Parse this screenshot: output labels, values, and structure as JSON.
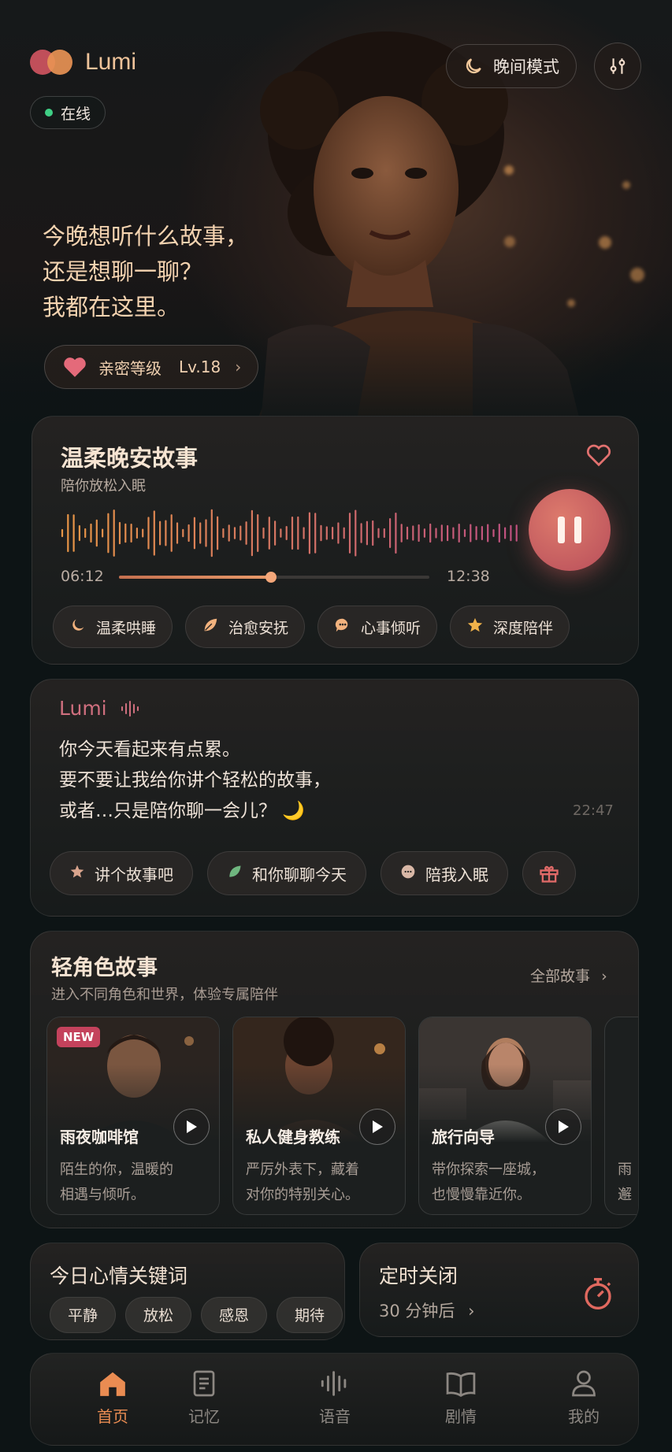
{
  "header": {
    "brand": "Lumi",
    "status": "在线",
    "night_mode": "晚间模式"
  },
  "hero": {
    "greeting_lines": [
      "今晚想听什么故事，",
      "还是想聊一聊？",
      "我都在这里。"
    ],
    "intimacy_label": "亲密等级",
    "intimacy_level": "Lv.18"
  },
  "story": {
    "title": "温柔晚安故事",
    "subtitle": "陪你放松入眠",
    "elapsed": "06:12",
    "total": "12:38",
    "progress": 0.49,
    "chips": [
      {
        "label": "温柔哄睡",
        "icon": "moon-icon"
      },
      {
        "label": "治愈安抚",
        "icon": "leaf-icon"
      },
      {
        "label": "心事倾听",
        "icon": "chat-icon"
      },
      {
        "label": "深度陪伴",
        "icon": "star-icon"
      }
    ]
  },
  "chat": {
    "sender": "Lumi",
    "lines": [
      "你今天看起来有点累。",
      "要不要让我给你讲个轻松的故事，",
      "或者…只是陪你聊一会儿？ 🌙"
    ],
    "time": "22:47",
    "actions": [
      {
        "label": "讲个故事吧",
        "icon": "star-icon"
      },
      {
        "label": "和你聊聊今天",
        "icon": "leaf-icon"
      },
      {
        "label": "陪我入眠",
        "icon": "chat-icon"
      }
    ]
  },
  "roles": {
    "title": "轻角色故事",
    "subtitle": "进入不同角色和世界，体验专属陪伴",
    "all_label": "全部故事",
    "new_badge": "NEW",
    "items": [
      {
        "name": "雨夜咖啡馆",
        "desc_lines": [
          "陌生的你，温暖的",
          "相遇与倾听。"
        ]
      },
      {
        "name": "私人健身教练",
        "desc_lines": [
          "严厉外表下，藏着",
          "对你的特别关心。"
        ]
      },
      {
        "name": "旅行向导",
        "desc_lines": [
          "带你探索一座城，",
          "也慢慢靠近你。"
        ]
      }
    ],
    "partial_lines": [
      "雨",
      "邂"
    ]
  },
  "mood": {
    "title": "今日心情关键词",
    "tags": [
      "平静",
      "放松",
      "感恩",
      "期待"
    ]
  },
  "timer": {
    "title": "定时关闭",
    "value": "30 分钟后"
  },
  "tabs": [
    {
      "label": "首页",
      "icon": "home-icon",
      "active": true
    },
    {
      "label": "记忆",
      "icon": "notes-icon",
      "active": false
    },
    {
      "label": "语音",
      "icon": "voice-icon",
      "active": false
    },
    {
      "label": "剧情",
      "icon": "book-icon",
      "active": false
    },
    {
      "label": "我的",
      "icon": "profile-icon",
      "active": false
    }
  ],
  "colors": {
    "accent": "#ea8c52",
    "brand_pink": "#c04f5a",
    "online": "#3fcf85",
    "new_badge": "#c4425c"
  }
}
